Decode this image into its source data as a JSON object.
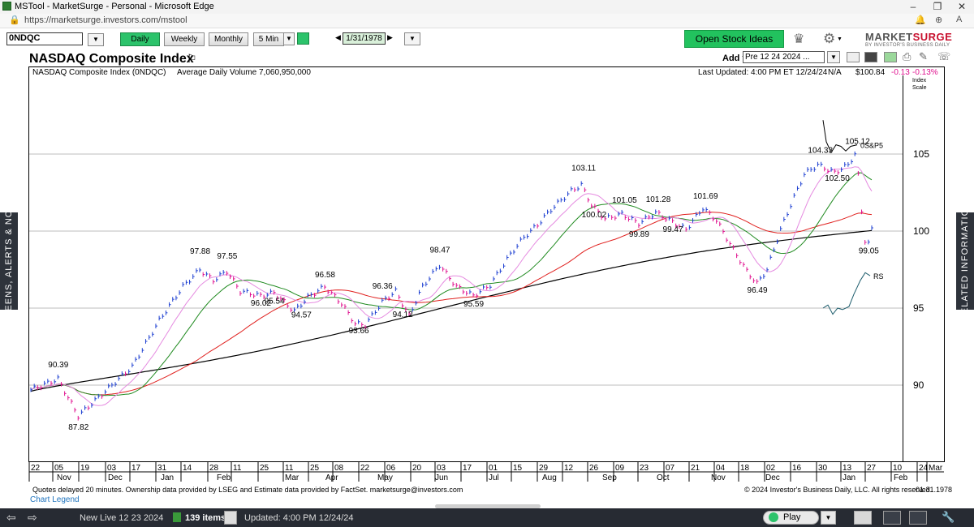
{
  "window": {
    "title": "MSTool - MarketSurge - Personal - Microsoft Edge",
    "url": "https://marketsurge.investors.com/mstool"
  },
  "toolbar": {
    "symbol": "0NDQC",
    "timeframes": [
      "Daily",
      "Weekly",
      "Monthly",
      "5 Min"
    ],
    "active_timeframe": "Daily",
    "date": "1/31/1978",
    "open_ideas": "Open Stock Ideas",
    "brand_pre": "MARKET",
    "brand_post": "SURGE",
    "brand_sub": "BY INVESTOR'S BUSINESS DAILY"
  },
  "header": {
    "title": "NASDAQ Composite Index",
    "add_to_list_label": "Add to List:",
    "add_to_list_value": "Pre 12 24 2024 ...",
    "info_name": "NASDAQ Composite Index  (0NDQC)",
    "info_volume": "Average Daily Volume 7,060,950,000",
    "last_updated": "Last Updated: 4:00 PM ET 12/24/24",
    "na": "N/A",
    "price": "$100.84",
    "change": "-0.13",
    "change_pct": "-0.13%",
    "index_scale": "Index Scale"
  },
  "side": {
    "left": "SCREENS, ALERTS & NOTES",
    "right": "RELATED INFORMATION"
  },
  "footer": {
    "note": "Quotes delayed 20 minutes. Ownership data provided by LSEG and Estimate data provided by FactSet. marketsurge@investors.com",
    "copyright": "© 2024 Investor's Business Daily, LLC. All rights reserved.",
    "date": "01.31.1978",
    "chart_legend": "Chart Legend"
  },
  "bottombar": {
    "list": "New Live 12 23 2024",
    "items": "139 items",
    "updated": "Updated: 4:00 PM 12/24/24",
    "play": "Play"
  },
  "colors": {
    "up": "#1d3fd1",
    "down": "#e0118f",
    "ma10": "#e58ae0",
    "ma21": "#1f8a1f",
    "ma50": "#e0201e",
    "ma200": "#000000",
    "sp500": "#000000",
    "rs": "#1f5e6e",
    "accent": "#22c25e"
  },
  "chart_data": {
    "type": "line",
    "title": "NASDAQ Composite Index",
    "ylabel": "Index Scale",
    "ylim": [
      86.2,
      110.2
    ],
    "y_ticks": [
      90,
      95,
      100,
      105
    ],
    "x_ticks": [
      "22",
      "05",
      "19",
      "03",
      "17",
      "31",
      "14",
      "28",
      "11",
      "25",
      "11",
      "25",
      "08",
      "22",
      "06",
      "20",
      "03",
      "17",
      "01",
      "15",
      "29",
      "12",
      "26",
      "09",
      "23",
      "07",
      "21",
      "04",
      "18",
      "02",
      "16",
      "30",
      "13",
      "27",
      "10",
      "24",
      "Mar"
    ],
    "months": [
      "Nov",
      "Dec",
      "Jan",
      "Feb",
      "Mar",
      "Apr",
      "May",
      "Jun",
      "Jul",
      "Aug",
      "Sep",
      "Oct",
      "Nov",
      "Dec",
      "Jan",
      "Feb"
    ],
    "price_annotations": [
      "90.39",
      "87.82",
      "97.88",
      "97.55",
      "96.02",
      "95.54",
      "94.57",
      "96.58",
      "93.66",
      "96.36",
      "94.12",
      "98.47",
      "95.59",
      "103.11",
      "100.02",
      "101.05",
      "99.89",
      "101.28",
      "99.47",
      "101.69",
      "96.49",
      "104.33",
      "105.12",
      "102.50",
      "99.05"
    ],
    "series": [
      {
        "name": "0S&P5",
        "points": [
          [
            1,
            107.2
          ],
          [
            3,
            105.8
          ],
          [
            6,
            105.1
          ],
          [
            9,
            105.6
          ],
          [
            12,
            105.5
          ],
          [
            15,
            105.2
          ],
          [
            18,
            105.5
          ],
          [
            22,
            105.6
          ]
        ]
      },
      {
        "name": "RS",
        "points": [
          [
            1,
            95.0
          ],
          [
            4,
            95.2
          ],
          [
            7,
            94.6
          ],
          [
            10,
            95.0
          ],
          [
            13,
            94.9
          ],
          [
            17,
            95.1
          ],
          [
            20,
            95.9
          ],
          [
            24,
            96.8
          ],
          [
            27,
            97.3
          ],
          [
            30,
            97.1
          ]
        ]
      }
    ]
  }
}
